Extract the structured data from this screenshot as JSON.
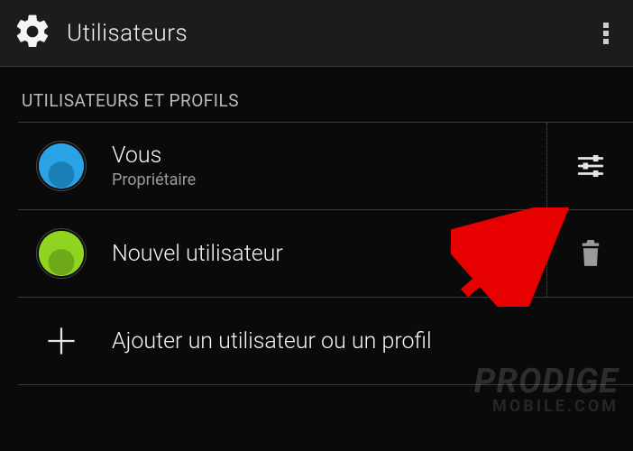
{
  "appbar": {
    "title": "Utilisateurs"
  },
  "section": {
    "header": "UTILISATEURS ET PROFILS"
  },
  "users": [
    {
      "name": "Vous",
      "subtitle": "Propriétaire",
      "avatar_color": "#29a3e6",
      "avatar_inner": "#1a7fb5",
      "action_icon": "sliders"
    },
    {
      "name": "Nouvel utilisateur",
      "subtitle": "",
      "avatar_color": "#8fd421",
      "avatar_inner": "#6fa818",
      "action_icon": "trash"
    }
  ],
  "add_row": {
    "label": "Ajouter un utilisateur ou un profil"
  },
  "watermark": {
    "line1": "PRODIGE",
    "line2": "MOBILE.COM"
  },
  "annotation": {
    "arrow_color": "#e60000"
  }
}
